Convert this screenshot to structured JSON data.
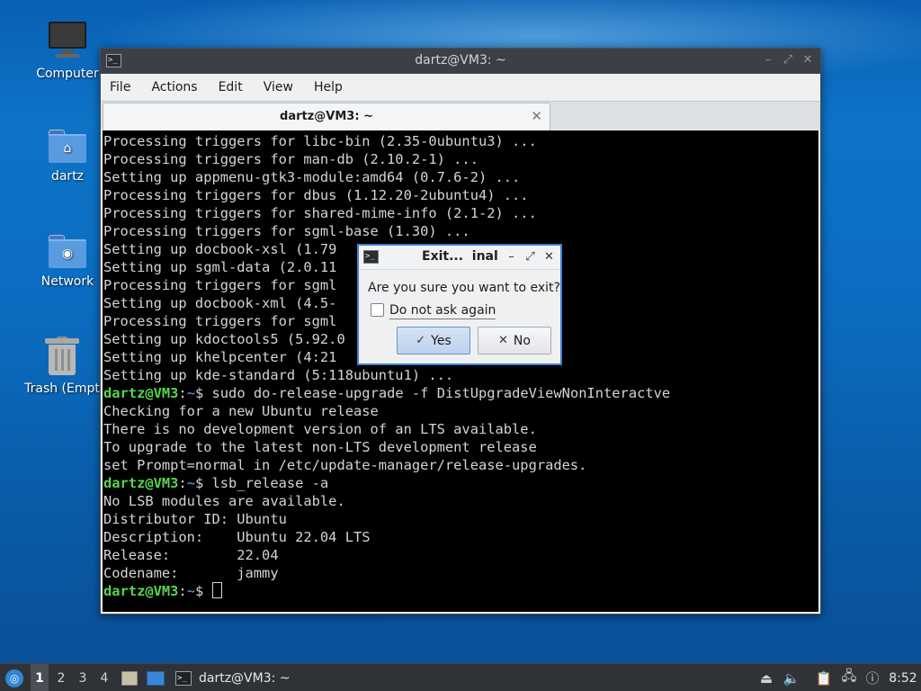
{
  "desktop": {
    "icons": [
      {
        "label": "Computer",
        "icon": "computer-icon"
      },
      {
        "label": "dartz",
        "icon": "home-folder-icon"
      },
      {
        "label": "Network",
        "icon": "network-folder-icon"
      },
      {
        "label": "Trash (Empt",
        "icon": "trash-icon"
      }
    ]
  },
  "terminal": {
    "window_title": "dartz@VM3: ~",
    "menu": [
      "File",
      "Actions",
      "Edit",
      "View",
      "Help"
    ],
    "tab_label": "dartz@VM3: ~",
    "prompt_user": "dartz@VM3",
    "prompt_sep": ":",
    "prompt_path": "~",
    "prompt_dollar": "$ ",
    "lines": [
      "Processing triggers for libc-bin (2.35-0ubuntu3) ...",
      "Processing triggers for man-db (2.10.2-1) ...",
      "Setting up appmenu-gtk3-module:amd64 (0.7.6-2) ...",
      "Processing triggers for dbus (1.12.20-2ubuntu4) ...",
      "Processing triggers for shared-mime-info (2.1-2) ...",
      "Processing triggers for sgml-base (1.30) ...",
      "Setting up docbook-xsl (1.79",
      "Setting up sgml-data (2.0.11",
      "Processing triggers for sgml",
      "Setting up docbook-xml (4.5-",
      "Processing triggers for sgml",
      "Setting up kdoctools5 (5.92.0",
      "Setting up khelpcenter (4:21",
      "Setting up kde-standard (5:118ubuntu1) ...",
      "sudo do-release-upgrade -f DistUpgradeViewNonInteractve",
      "Checking for a new Ubuntu release",
      "There is no development version of an LTS available.",
      "To upgrade to the latest non-LTS development release",
      "set Prompt=normal in /etc/update-manager/release-upgrades.",
      "lsb_release -a",
      "No LSB modules are available.",
      "Distributor ID: Ubuntu",
      "Description:    Ubuntu 22.04 LTS",
      "Release:        22.04",
      "Codename:       jammy"
    ]
  },
  "dialog": {
    "title": "Exit...  inal",
    "message": "Are you sure you want to exit?",
    "checkbox_label": "Do not ask again",
    "checkbox_checked": false,
    "yes_label": "Yes",
    "no_label": "No"
  },
  "taskbar": {
    "workspaces": [
      "1",
      "2",
      "3",
      "4"
    ],
    "active_workspace": "1",
    "task_label": "dartz@VM3: ~",
    "clock": "8:52"
  },
  "colors": {
    "prompt_user": "#56d64b",
    "prompt_path": "#4f7fd8",
    "dialog_border": "#3d7fd1"
  }
}
